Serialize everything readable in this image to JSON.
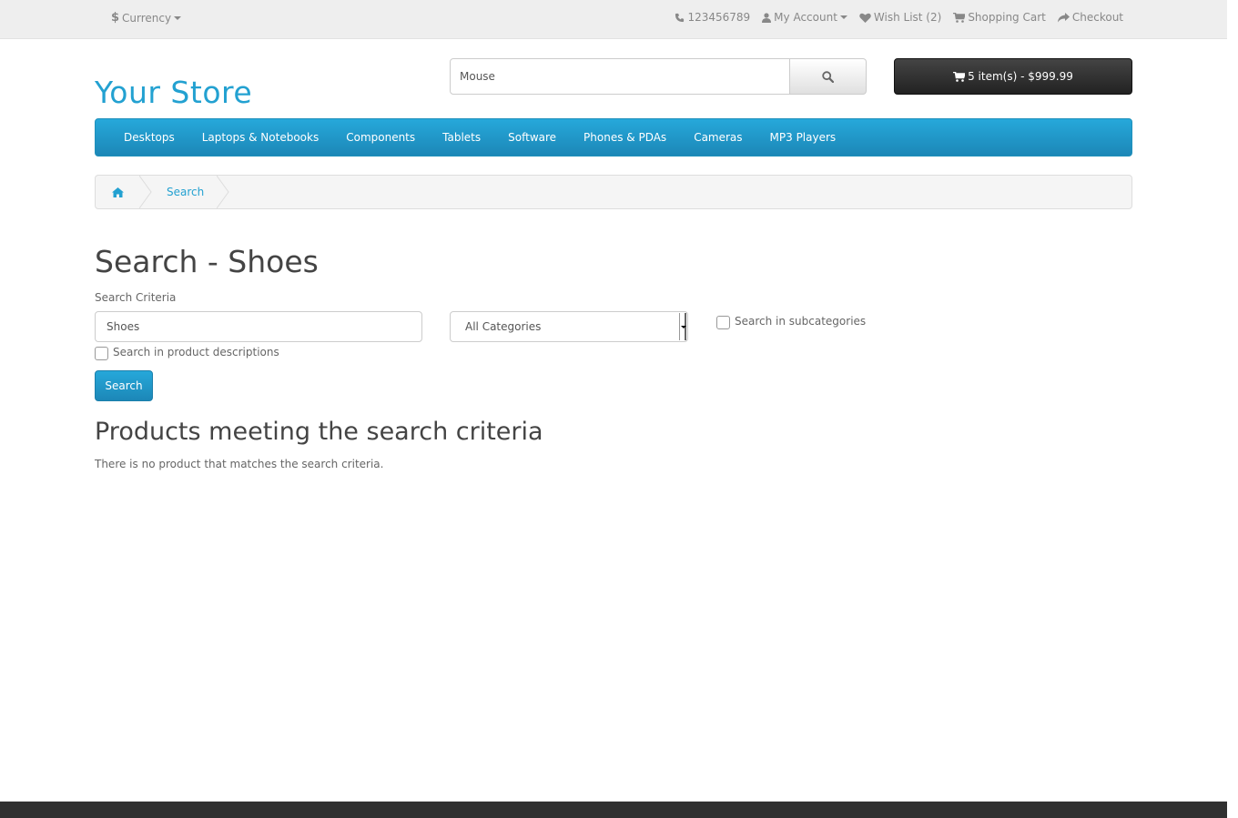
{
  "topbar": {
    "currency_symbol": "$",
    "currency_label": "Currency",
    "phone": "123456789",
    "my_account": "My Account",
    "wish_list": "Wish List (2)",
    "shopping_cart": "Shopping Cart",
    "checkout": "Checkout"
  },
  "header": {
    "logo": "Your Store",
    "search_value": "Mouse",
    "cart_summary": "5 item(s) - $999.99"
  },
  "menu": {
    "items": [
      "Desktops",
      "Laptops & Notebooks",
      "Components",
      "Tablets",
      "Software",
      "Phones & PDAs",
      "Cameras",
      "MP3 Players"
    ]
  },
  "breadcrumb": {
    "current": "Search"
  },
  "search_page": {
    "title": "Search - Shoes",
    "criteria_label": "Search Criteria",
    "criteria_value": "Shoes",
    "category_selected": "All Categories",
    "subcategories_label": "Search in subcategories",
    "descriptions_label": "Search in product descriptions",
    "submit_label": "Search",
    "results_title": "Products meeting the search criteria",
    "no_results": "There is no product that matches the search criteria."
  },
  "colors": {
    "accent": "#23a1d1",
    "menu_bg": "#229ac8",
    "cart_bg": "#363636",
    "footer_bg": "#303030"
  }
}
